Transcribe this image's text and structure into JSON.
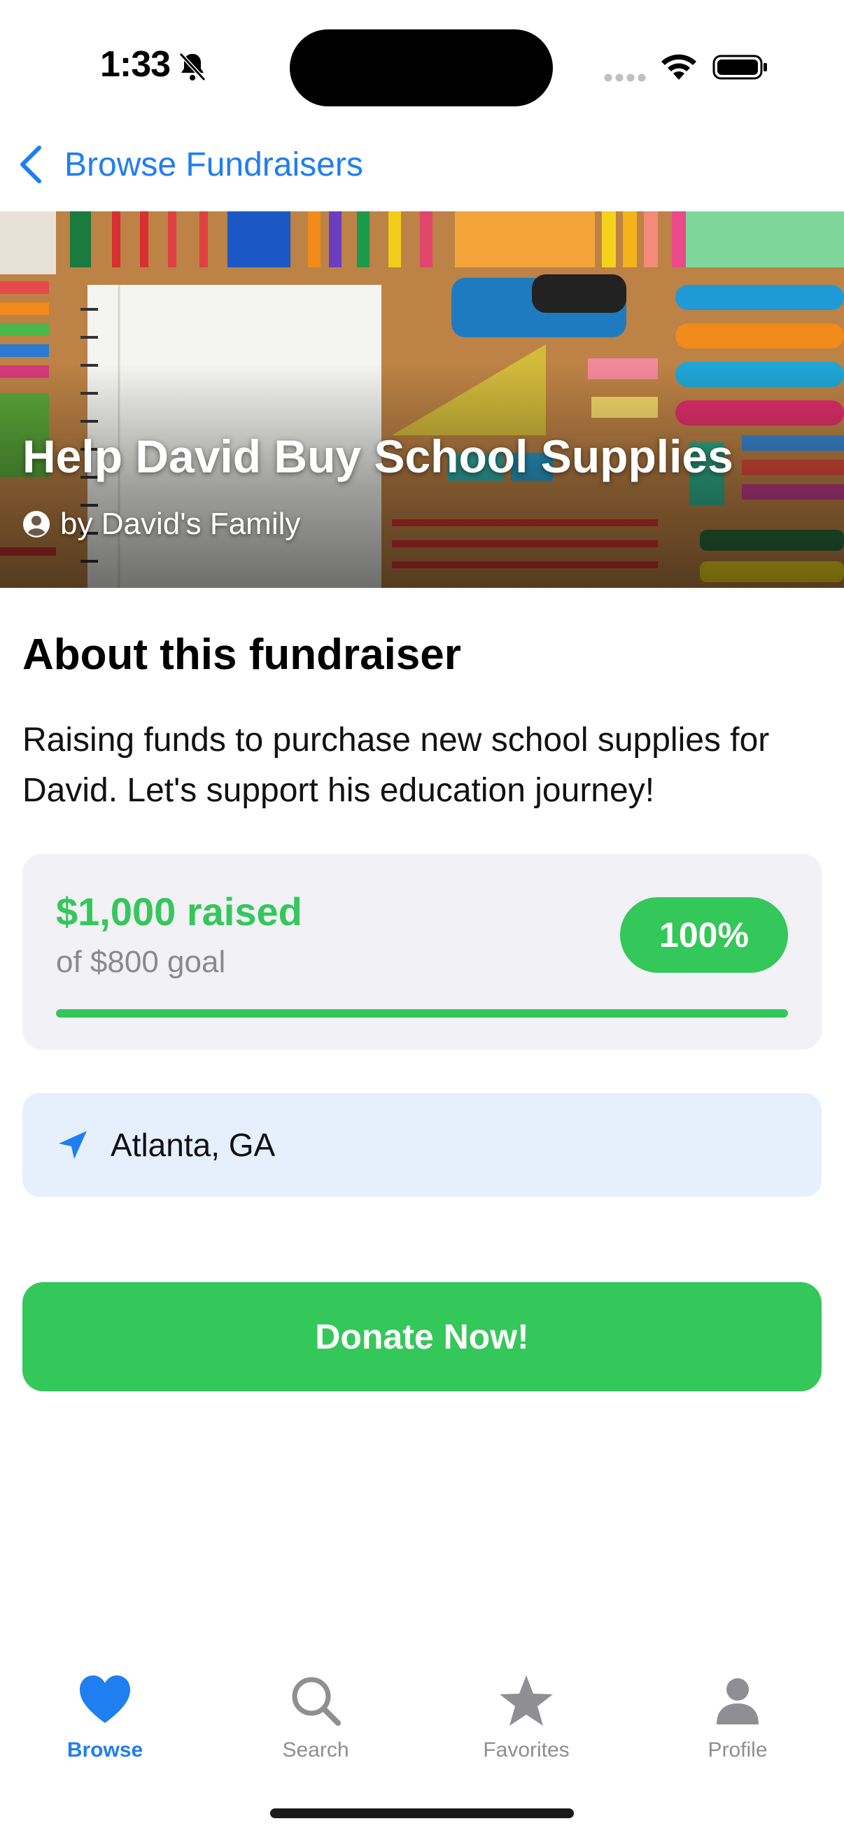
{
  "status_bar": {
    "time": "1:33",
    "icons": [
      "bell-slash-icon",
      "signal-dots-icon",
      "wifi-icon",
      "battery-icon"
    ]
  },
  "nav": {
    "back_label": "Browse Fundraisers",
    "back_icon": "chevron-left-icon"
  },
  "hero": {
    "title": "Help David Buy School Supplies",
    "byline": "by David's Family",
    "byline_icon": "person-circle-icon"
  },
  "about": {
    "heading": "About this fundraiser",
    "text": "Raising funds to purchase new school supplies for David. Let's support his education journey!"
  },
  "progress": {
    "raised": "$1,000 raised",
    "goal": "of $800 goal",
    "percent_label": "100%",
    "fill_fraction": 1.0
  },
  "location": {
    "icon": "location-arrow-icon",
    "text": "Atlanta, GA"
  },
  "donate": {
    "label": "Donate Now!"
  },
  "tabs": [
    {
      "label": "Browse",
      "icon": "heart-icon",
      "active": true
    },
    {
      "label": "Search",
      "icon": "magnifier-icon",
      "active": false
    },
    {
      "label": "Favorites",
      "icon": "star-icon",
      "active": false
    },
    {
      "label": "Profile",
      "icon": "person-icon",
      "active": false
    }
  ],
  "colors": {
    "accent_blue": "#1f7ef0",
    "accent_green": "#34c759",
    "card_gray": "#f1f1f6",
    "location_bg": "#e6f0fd",
    "inactive_gray": "#8e8e93"
  }
}
